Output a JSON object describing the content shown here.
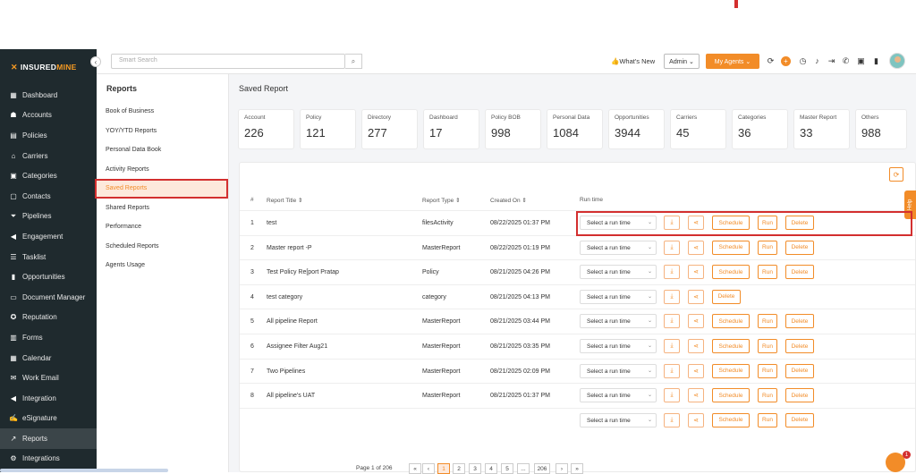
{
  "brand": {
    "insured": "INSURED",
    "mine": "MINE"
  },
  "sidebar": {
    "items": [
      {
        "label": "Dashboard",
        "icon": "grid-icon",
        "glyph": "▦"
      },
      {
        "label": "Accounts",
        "icon": "users-icon",
        "glyph": "☗"
      },
      {
        "label": "Policies",
        "icon": "document-icon",
        "glyph": "▤"
      },
      {
        "label": "Carriers",
        "icon": "building-icon",
        "glyph": "⌂"
      },
      {
        "label": "Categories",
        "icon": "categories-icon",
        "glyph": "▣"
      },
      {
        "label": "Contacts",
        "icon": "contact-card-icon",
        "glyph": "▢"
      },
      {
        "label": "Pipelines",
        "icon": "filter-icon",
        "glyph": "⏷"
      },
      {
        "label": "Engagement",
        "icon": "megaphone-icon",
        "glyph": "◀"
      },
      {
        "label": "Tasklist",
        "icon": "list-icon",
        "glyph": "☰"
      },
      {
        "label": "Opportunities",
        "icon": "bar-chart-icon",
        "glyph": "▮"
      },
      {
        "label": "Document Manager",
        "icon": "folder-icon",
        "glyph": "▭"
      },
      {
        "label": "Reputation",
        "icon": "badge-icon",
        "glyph": "✪"
      },
      {
        "label": "Forms",
        "icon": "form-icon",
        "glyph": "▥"
      },
      {
        "label": "Calendar",
        "icon": "calendar-icon",
        "glyph": "▦"
      },
      {
        "label": "Work Email",
        "icon": "email-icon",
        "glyph": "✉"
      },
      {
        "label": "Integration",
        "icon": "integration-icon",
        "glyph": "◀"
      },
      {
        "label": "eSignature",
        "icon": "signature-icon",
        "glyph": "✍"
      },
      {
        "label": "Reports",
        "icon": "line-chart-icon",
        "glyph": "↗"
      },
      {
        "label": "Integrations",
        "icon": "gears-icon",
        "glyph": "⚙"
      }
    ]
  },
  "header": {
    "search_placeholder": "Smart Search",
    "whats_new": "👍What's New",
    "admin": "Admin ⌄",
    "my_agents": "My Agents ⌄"
  },
  "subnav": {
    "title": "Reports",
    "items": [
      "Book of Business",
      "YOY/YTD Reports",
      "Personal Data Book",
      "Activity Reports",
      "Saved Reports",
      "Shared Reports",
      "Performance",
      "Scheduled Reports",
      "Agents Usage"
    ]
  },
  "main": {
    "title": "Saved Report",
    "stats": [
      {
        "label": "Account",
        "value": "226"
      },
      {
        "label": "Policy",
        "value": "121"
      },
      {
        "label": "Directory",
        "value": "277"
      },
      {
        "label": "Dashboard",
        "value": "17"
      },
      {
        "label": "Policy BOB",
        "value": "998"
      },
      {
        "label": "Personal Data",
        "value": "1084"
      },
      {
        "label": "Opportunities",
        "value": "3944"
      },
      {
        "label": "Carriers",
        "value": "45"
      },
      {
        "label": "Categories",
        "value": "36"
      },
      {
        "label": "Master Report",
        "value": "33"
      },
      {
        "label": "Others",
        "value": "988"
      }
    ]
  },
  "table": {
    "headers": {
      "num": "#",
      "title": "Report Title ⇕",
      "type": "Report Type ⇕",
      "created": "Created On ⇕",
      "run": "Run time"
    },
    "run_placeholder": "Select a run time",
    "actions": {
      "schedule": "Schedule",
      "run": "Run",
      "delete": "Delete"
    },
    "rows": [
      {
        "num": "1",
        "title": "test",
        "type": "filesActivity",
        "created": "08/22/2025 01:37 PM"
      },
      {
        "num": "2",
        "title": "Master report -P",
        "type": "MasterReport",
        "created": "08/22/2025 01:19 PM"
      },
      {
        "num": "3",
        "title": "Test Policy Re[port Pratap",
        "type": "Policy",
        "created": "08/21/2025 04:26 PM"
      },
      {
        "num": "4",
        "title": "test category",
        "type": "category",
        "created": "08/21/2025 04:13 PM"
      },
      {
        "num": "5",
        "title": "All pipeline Report",
        "type": "MasterReport",
        "created": "08/21/2025 03:44 PM"
      },
      {
        "num": "6",
        "title": "Assignee Filter Aug21",
        "type": "MasterReport",
        "created": "08/21/2025 03:35 PM"
      },
      {
        "num": "7",
        "title": "Two Pipelines",
        "type": "MasterReport",
        "created": "08/21/2025 02:09 PM"
      },
      {
        "num": "8",
        "title": "All pipeline's UAT",
        "type": "MasterReport",
        "created": "08/21/2025 01:37 PM"
      }
    ]
  },
  "pagination": {
    "label": "Page 1 of 206",
    "pages": [
      "«",
      "‹",
      "1",
      "2",
      "3",
      "4",
      "5",
      "...",
      "206",
      "›",
      "»"
    ]
  },
  "help": "Help",
  "chat_badge": "1"
}
